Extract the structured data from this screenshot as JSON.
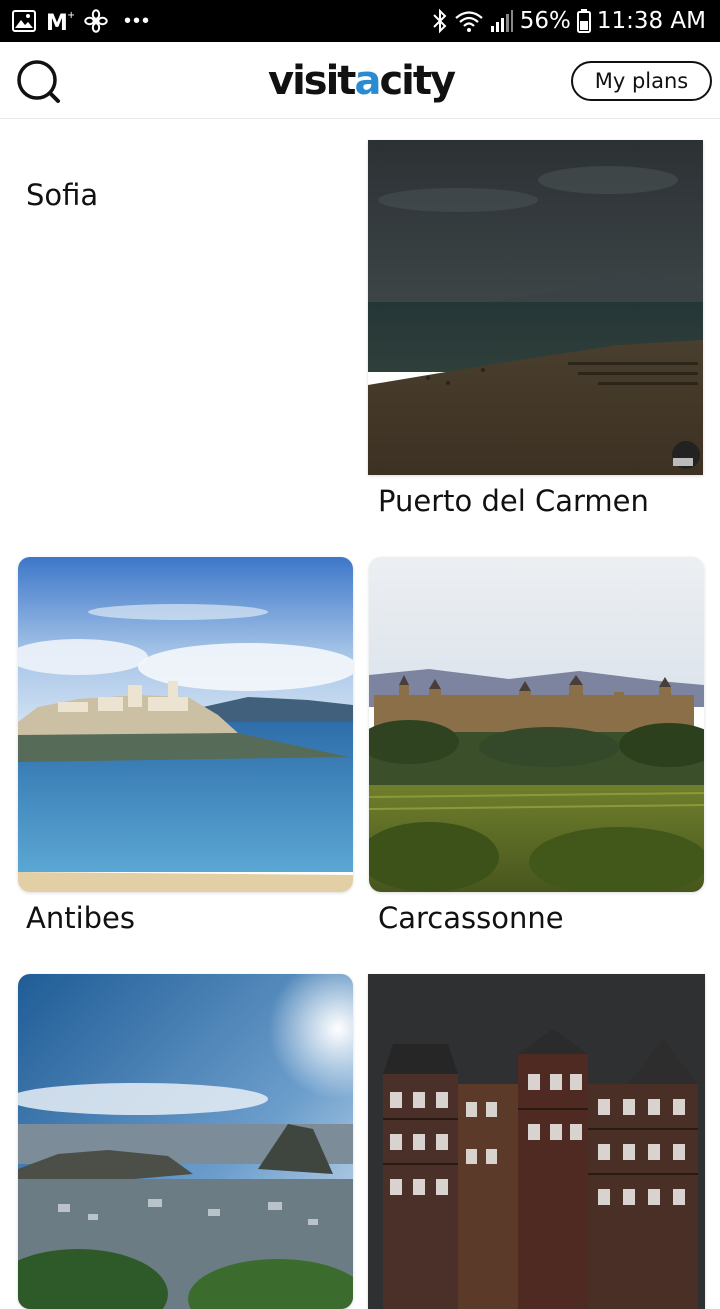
{
  "status_bar": {
    "battery": "56%",
    "time": "11:38 AM",
    "notification_dots": "•••",
    "icons": [
      "gallery-icon",
      "gmail-icon",
      "fan-icon",
      "bluetooth-icon",
      "wifi-icon",
      "signal-icon",
      "battery-icon"
    ]
  },
  "header": {
    "logo_part1": "visit",
    "logo_accent": "a",
    "logo_part2": "city",
    "my_plans_label": "My plans",
    "accent_color": "#2a8bd0"
  },
  "cities": [
    {
      "name": "Sofia"
    },
    {
      "name": "Puerto del Carmen"
    },
    {
      "name": "Antibes"
    },
    {
      "name": "Carcassonne"
    },
    {
      "name": ""
    },
    {
      "name": ""
    }
  ]
}
